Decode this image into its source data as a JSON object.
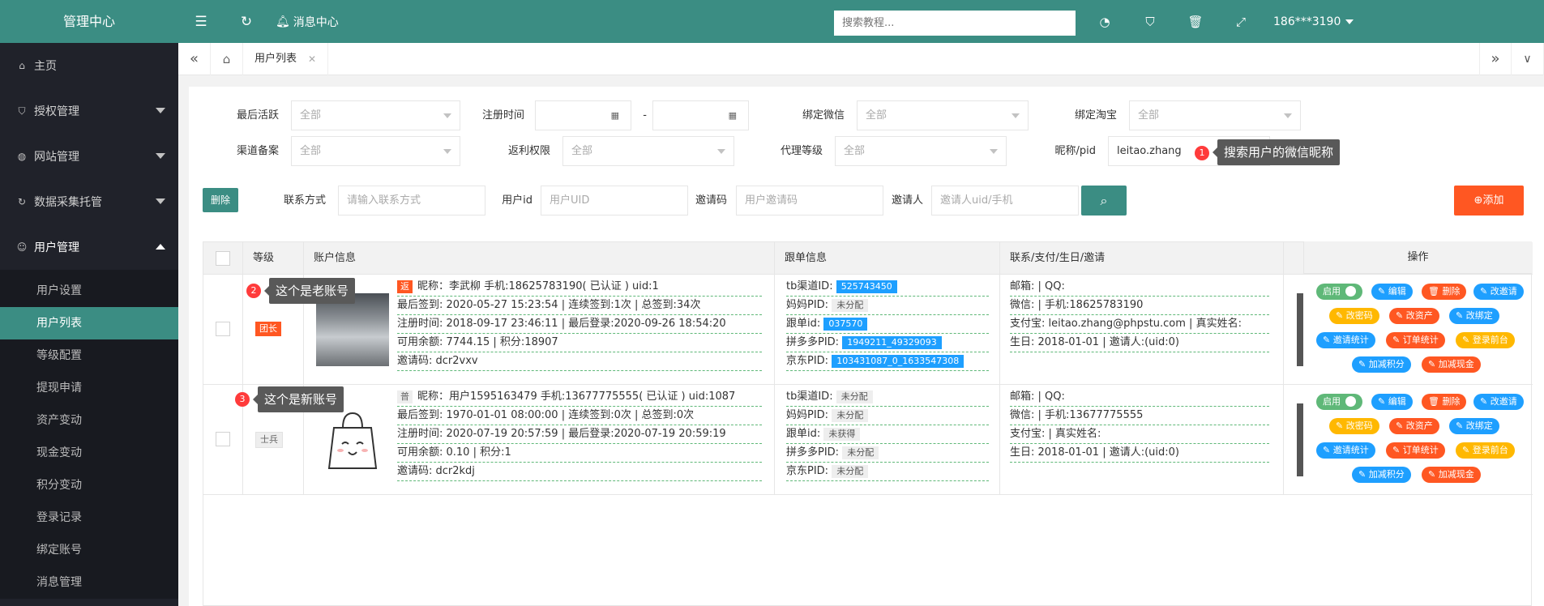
{
  "app": {
    "title": "管理中心"
  },
  "sidebar": {
    "items": [
      {
        "label": "主页",
        "icon": "home-icon"
      },
      {
        "label": "授权管理",
        "icon": "shield-icon"
      },
      {
        "label": "网站管理",
        "icon": "globe-icon"
      },
      {
        "label": "数据采集托管",
        "icon": "sync-icon"
      },
      {
        "label": "用户管理",
        "icon": "user-icon"
      }
    ],
    "sub": [
      "用户设置",
      "用户列表",
      "等级配置",
      "提现申请",
      "资产变动",
      "现金变动",
      "积分变动",
      "登录记录",
      "绑定账号",
      "消息管理"
    ]
  },
  "topbar": {
    "message": "消息中心",
    "search_placeholder": "搜索教程...",
    "user": "186***3190"
  },
  "tabs": {
    "current": "用户列表"
  },
  "filters": {
    "last_active": "最后活跃",
    "reg_time": "注册时间",
    "bind_wechat": "绑定微信",
    "bind_taobao": "绑定淘宝",
    "channel": "渠道备案",
    "rebate": "返利权限",
    "agent": "代理等级",
    "nickname": "昵称/pid",
    "all": "全部",
    "dash": "-",
    "nick_value": "leitao.zhang",
    "contact": "联系方式",
    "contact_ph": "请输入联系方式",
    "uid": "用户id",
    "uid_ph": "用户UID",
    "invite": "邀请码",
    "invite_ph": "用户邀请码",
    "inviter": "邀请人",
    "inviter_ph": "邀请人uid/手机",
    "delete": "删除",
    "add": "⊕添加"
  },
  "tips": {
    "t1": "搜索用户的微信昵称",
    "t2": "这个是老账号",
    "t3": "这个是新账号",
    "n1": "1",
    "n2": "2",
    "n3": "3"
  },
  "table": {
    "headers": [
      "等级",
      "账户信息",
      "跟单信息",
      "联系/支付/生日/邀请",
      "操作"
    ],
    "rows": [
      {
        "level": "团长",
        "tag": "返",
        "line1": "昵称：李武柳  手机:18625783190( 已认证 )   uid:1",
        "line2": "最后签到: 2020-05-27 15:23:54  |  连续签到:1次  |  总签到:34次",
        "line3": "注册时间: 2018-09-17 23:46:11  |  最后登录:2020-09-26 18:54:20",
        "line4": "可用余额: 7744.15  |  积分:18907",
        "line5": "邀请码: dcr2vxv",
        "f1": "tb渠道ID:",
        "f1v": "525743450",
        "f2": "妈妈PID:",
        "f2v": "未分配",
        "f3": "跟单id:",
        "f3v": "037570",
        "f4": "拼多多PID:",
        "f4v": "1949211_49329093",
        "f5": "京东PID:",
        "f5v": "103431087_0_1633547308",
        "c1": "邮箱:  |  QQ:",
        "c2": "微信:  |  手机:18625783190",
        "c3": "支付宝: leitao.zhang@phpstu.com  |  真实姓名:",
        "c4": "生日: 2018-01-01  |  邀请人:(uid:0)"
      },
      {
        "level": "士兵",
        "tag": "普",
        "line1": "昵称：用户1595163479  手机:13677775555( 已认证 )   uid:1087",
        "line2": "最后签到: 1970-01-01 08:00:00  |  连续签到:0次  |  总签到:0次",
        "line3": "注册时间: 2020-07-19 20:57:59  |  最后登录:2020-07-19 20:59:19",
        "line4": "可用余额: 0.10  |  积分:1",
        "line5": "邀请码: dcr2kdj",
        "f1": "tb渠道ID:",
        "f1v": "未分配",
        "f2": "妈妈PID:",
        "f2v": "未分配",
        "f3": "跟单id:",
        "f3v": "未获得",
        "f4": "拼多多PID:",
        "f4v": "未分配",
        "f5": "京东PID:",
        "f5v": "未分配",
        "c1": "邮箱:  |  QQ:",
        "c2": "微信:  |  手机:13677775555",
        "c3": "支付宝:  |  真实姓名:",
        "c4": "生日: 2018-01-01  |  邀请人:(uid:0)"
      }
    ]
  },
  "ops": {
    "enable": "启用",
    "edit": "✎ 编辑",
    "del": "🗑 删除",
    "chg_invite": "✎ 改邀请",
    "chg_pwd": "✎ 改密码",
    "chg_asset": "✎ 改资产",
    "chg_bind": "✎ 改绑定",
    "invite_stat": "✎ 邀请统计",
    "order_stat": "✎ 订单统计",
    "login_front": "✎ 登录前台",
    "add_points": "✎ 加减积分",
    "add_cash": "✎ 加减现金"
  },
  "colors": {
    "brand": "#3b8d83",
    "sidebar": "#20222a",
    "orange": "#ff5722",
    "blue": "#1e9fff"
  }
}
